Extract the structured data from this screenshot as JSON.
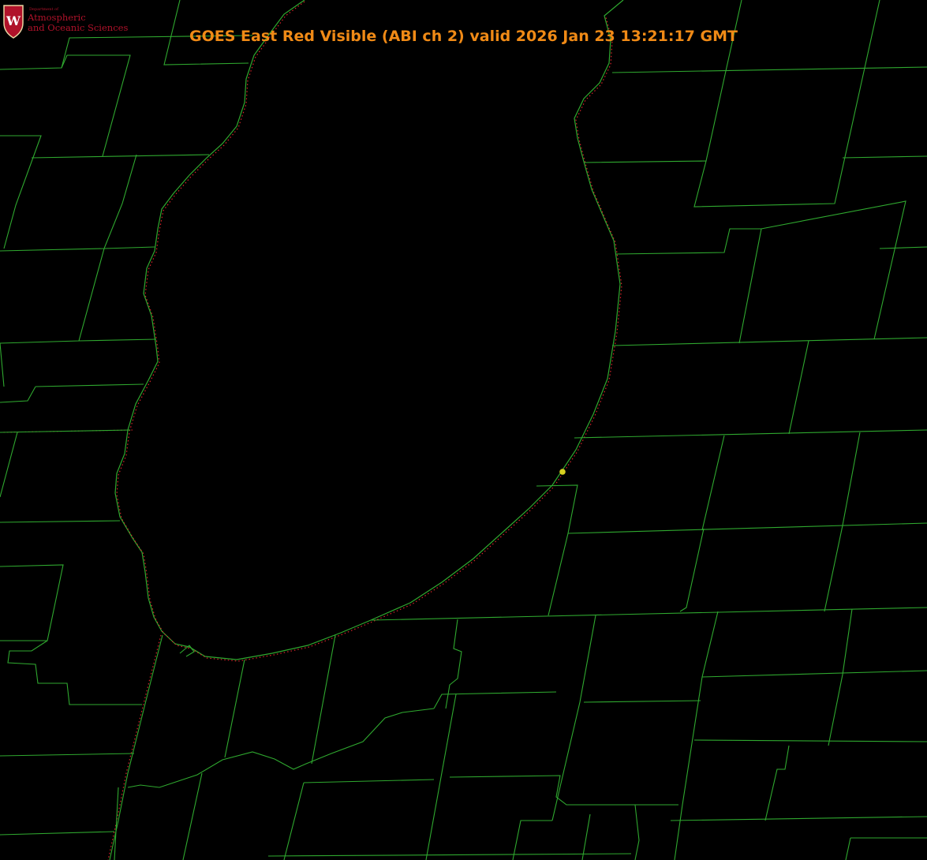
{
  "header": {
    "title": "GOES East Red Visible (ABI ch 2) valid 2026 Jan 23 13:21:17 GMT"
  },
  "logo": {
    "dept_label": "Department of",
    "line1": "Atmospheric",
    "line2": "and Oceanic Sciences",
    "shield_letter": "W"
  },
  "colors": {
    "background": "#000000",
    "boundaries": "#2fa82f",
    "shoreline_dotted": "#d9262b",
    "title": "#f08a16",
    "marker": "#d8d020",
    "logo": "#b0122a"
  },
  "icons": {
    "station_marker": "yellow-dot-icon",
    "logo_shield": "uw-crest-icon"
  }
}
